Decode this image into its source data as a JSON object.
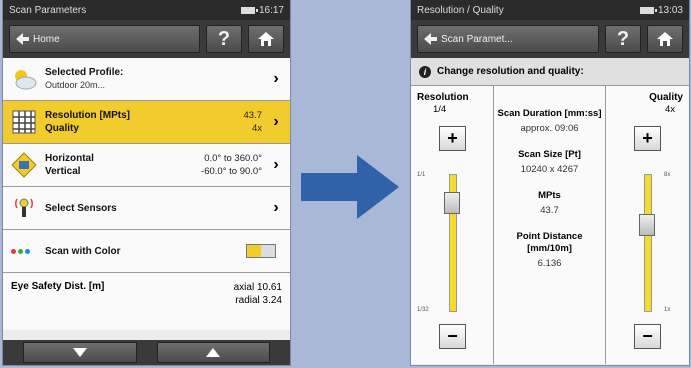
{
  "left_screen": {
    "status": {
      "title": "Scan Parameters",
      "time": "16:17"
    },
    "toolbar": {
      "back_label": "Home",
      "help_label": "?"
    },
    "rows": [
      {
        "title": "Selected Profile:",
        "subtitle": "Outdoor 20m...",
        "values": []
      },
      {
        "title": "Resolution [MPts]",
        "title2": "Quality",
        "values": [
          "43.7",
          "4x"
        ]
      },
      {
        "title": "Horizontal",
        "title2": "Vertical",
        "values": [
          "0.0° to 360.0°",
          "-60.0° to 90.0°"
        ]
      },
      {
        "title": "Select Sensors",
        "values": []
      },
      {
        "title": "Scan with Color",
        "values": []
      }
    ],
    "eye_safety": {
      "label": "Eye Safety Dist. [m]",
      "axial": "axial 10.61",
      "radial": "radial 3.24"
    },
    "dot_colors": [
      "#e53935",
      "#43a047",
      "#1e88e5"
    ]
  },
  "right_screen": {
    "status": {
      "title": "Resolution / Quality",
      "time": "13:03"
    },
    "toolbar": {
      "back_label": "Scan Paramet...",
      "help_label": "?"
    },
    "info": "Change resolution and quality:",
    "resolution": {
      "label": "Resolution",
      "value": "1/4",
      "tick_top": "1/1",
      "tick_bottom": "1/32"
    },
    "quality": {
      "label": "Quality",
      "value": "4x",
      "tick_top": "8x",
      "tick_bottom": "1x"
    },
    "stats": [
      {
        "key": "Scan Duration [mm:ss]",
        "value": "approx. 09:06"
      },
      {
        "key": "Scan Size [Pt]",
        "value": "10240 x 4267"
      },
      {
        "key": "MPts",
        "value": "43.7"
      },
      {
        "key": "Point Distance [mm/10m]",
        "value": "6.136"
      }
    ]
  },
  "colors": {
    "accent": "#f2cc2c",
    "arrow": "#2f62a8",
    "background": "#a9b8d6"
  }
}
